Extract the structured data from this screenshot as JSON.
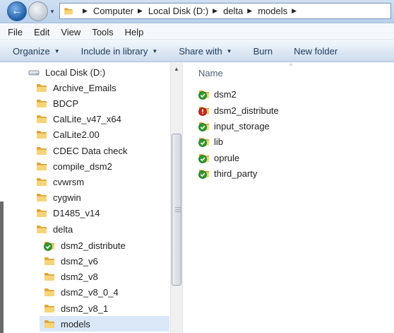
{
  "address": {
    "crumbs": [
      "Computer",
      "Local Disk (D:)",
      "delta",
      "models"
    ]
  },
  "menu": {
    "items": [
      "File",
      "Edit",
      "View",
      "Tools",
      "Help"
    ]
  },
  "toolbar": {
    "organize": "Organize",
    "include": "Include in library",
    "share": "Share with",
    "burn": "Burn",
    "new_folder": "New folder"
  },
  "nav": {
    "drive": "Local Disk (D:)",
    "folders": [
      "Archive_Emails",
      "BDCP",
      "CalLite_v47_x64",
      "CalLite2.00",
      "CDEC Data check",
      "compile_dsm2",
      "cvwrsm",
      "cygwin",
      "D1485_v14",
      "delta"
    ],
    "subfolders": [
      "dsm2_distribute",
      "dsm2_v6",
      "dsm2_v8",
      "dsm2_v8_0_4",
      "dsm2_v8_1",
      "models"
    ]
  },
  "content": {
    "column_name": "Name",
    "items": [
      "dsm2",
      "dsm2_distribute",
      "input_storage",
      "lib",
      "oprule",
      "third_party"
    ]
  },
  "colors": {
    "folder": "#e8b84a",
    "ok_overlay": "#2e9a2e",
    "error_overlay": "#c8281c",
    "selected_row": "#dbe8f8"
  }
}
